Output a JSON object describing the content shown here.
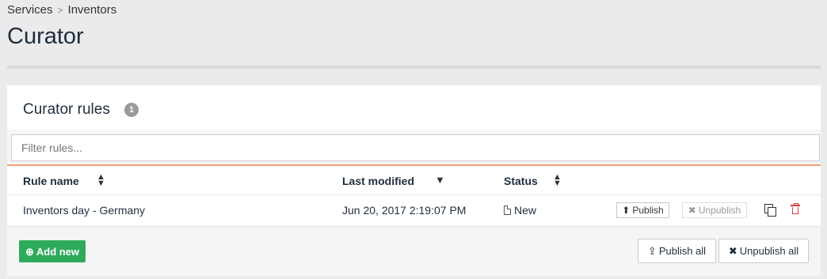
{
  "breadcrumb": {
    "items": [
      "Services",
      "Inventors"
    ],
    "separator": ">"
  },
  "page": {
    "title": "Curator"
  },
  "panel": {
    "title": "Curator rules",
    "count": "1",
    "filter": {
      "placeholder": "Filter rules...",
      "value": ""
    },
    "columns": {
      "name": "Rule name",
      "modified": "Last modified",
      "status": "Status"
    },
    "sort": {
      "column": "modified",
      "direction": "descending"
    },
    "rows": [
      {
        "name": "Inventors day - Germany",
        "modified": "Jun 20, 2017 2:19:07 PM",
        "status": "New",
        "publish_label": "Publish",
        "unpublish_label": "Unpublish",
        "unpublish_disabled": true
      }
    ],
    "footer": {
      "add_label": "Add new",
      "publish_all_label": "Publish all",
      "unpublish_all_label": "Unpublish all"
    }
  },
  "icons": {
    "copy": "copy-icon",
    "delete": "trash-icon",
    "status": "file-icon",
    "publish": "arrow-circle-up-icon",
    "unpublish": "times-icon",
    "add": "plus-circle-icon",
    "publish_all": "upload-icon"
  },
  "colors": {
    "primary": "#2dab5b",
    "danger": "#d43c3c",
    "accent": "#f0a272",
    "badge": "#9a9a9a"
  }
}
